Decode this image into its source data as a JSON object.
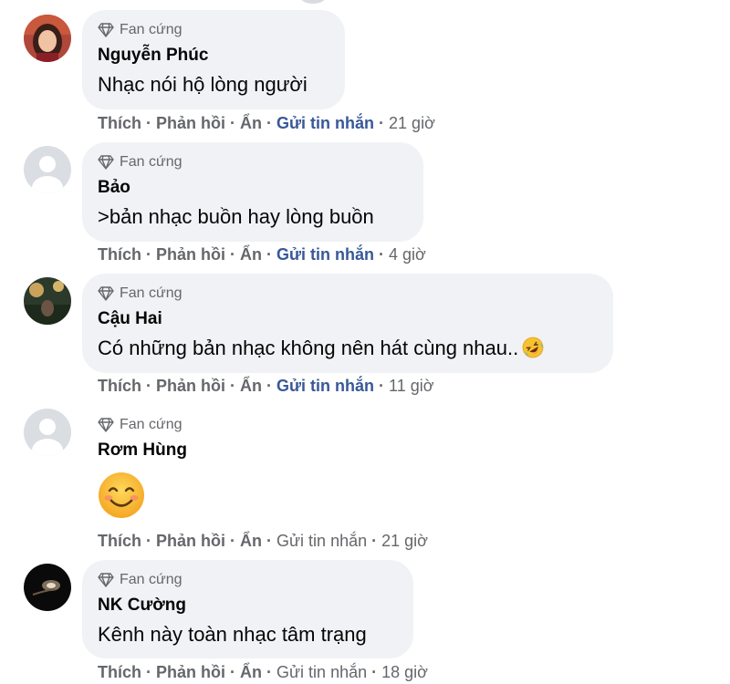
{
  "badge_label": "Fan cứng",
  "comments": [
    {
      "name": "Nguyễn Phúc",
      "text": "Nhạc nói hộ lòng người",
      "actions": {
        "like": "Thích",
        "reply": "Phản hồi",
        "hide": "Ẩn",
        "message": "Gửi tin nhắn",
        "time": "21 giờ"
      }
    },
    {
      "name": "Bảo",
      "text": ">bản nhạc buồn hay lòng buồn",
      "actions": {
        "like": "Thích",
        "reply": "Phản hồi",
        "hide": "Ẩn",
        "message": "Gửi tin nhắn",
        "time": "4 giờ"
      }
    },
    {
      "name": "Cậu Hai",
      "text": "Có những bản nhạc không nên hát cùng nhau..",
      "emoji": "rolling-on-floor-laughing",
      "actions": {
        "like": "Thích",
        "reply": "Phản hồi",
        "hide": "Ẩn",
        "message": "Gửi tin nhắn",
        "time": "11 giờ"
      }
    },
    {
      "name": "Rơm Hùng",
      "emoji": "smiling-face",
      "actions": {
        "like": "Thích",
        "reply": "Phản hồi",
        "hide": "Ẩn",
        "message": "Gửi tin nhắn",
        "time": "21 giờ"
      }
    },
    {
      "name": "NK Cường",
      "text": "Kênh này toàn nhạc tâm trạng",
      "actions": {
        "like": "Thích",
        "reply": "Phản hồi",
        "hide": "Ẩn",
        "message": "Gửi tin nhắn",
        "time": "18 giờ"
      }
    }
  ],
  "colors": {
    "bubble": "#f0f2f5",
    "secondary_text": "#65676b",
    "link_blue": "#385898"
  }
}
